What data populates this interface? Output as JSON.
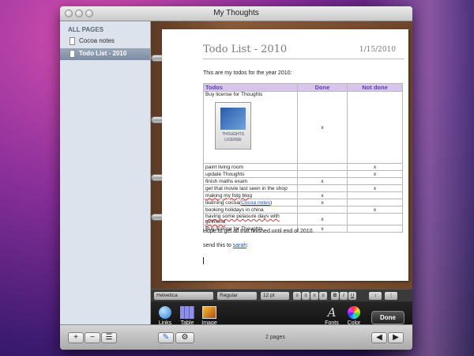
{
  "window": {
    "title": "My Thoughts"
  },
  "sidebar": {
    "header": "ALL PAGES",
    "items": [
      {
        "label": "Cocoa notes",
        "selected": false
      },
      {
        "label": "Todo List -  2010",
        "selected": true
      }
    ]
  },
  "page": {
    "title": "Todo List -  2010",
    "date": "1/15/2010",
    "intro": "This are my todos for the year 2010:",
    "table": {
      "headers": [
        "Todos",
        "Done",
        "Not done"
      ],
      "image_row": {
        "task": "Buy license for Thoughts",
        "image_label": "THOUGHTS LICENSE",
        "done": "x",
        "not_done": ""
      },
      "rows": [
        {
          "task": "paint living room",
          "done": "",
          "not_done": "x"
        },
        {
          "task": "update Thoughts",
          "done": "",
          "not_done": "x"
        },
        {
          "task": "finish maths exam",
          "done": "x",
          "not_done": ""
        },
        {
          "task": "get that movie last seen in the shop",
          "done": "",
          "not_done": "x"
        },
        {
          "task": "making my fotg blog",
          "done": "x",
          "not_done": ""
        },
        {
          "task_prefix": "learning cocoa(",
          "task_link": "Cocoa notes",
          "task_suffix": ")",
          "done": "x",
          "not_done": ""
        },
        {
          "task": "booking holidays in china",
          "done": "",
          "not_done": "x"
        },
        {
          "task": "having some pelasure days with girlfriend",
          "done": "x",
          "not_done": ""
        },
        {
          "task": "Buy license for Thoughts",
          "done": "x",
          "not_done": ""
        }
      ]
    },
    "outro": "Hope to get all that finished until end of 2010.",
    "send_prefix": "send this to ",
    "send_link": "sarah",
    "send_suffix": ":"
  },
  "format_bar": {
    "font": "Helvetica",
    "style": "Regular",
    "size": "12 pt",
    "bold": "B",
    "italic": "I",
    "underline": "U"
  },
  "toolbar": {
    "links": "Links",
    "table": "Table",
    "image": "Image",
    "fonts": "Fonts",
    "color": "Color",
    "done": "Done"
  },
  "bottom": {
    "pages_label": "2 pages",
    "add": "+",
    "remove": "−"
  }
}
